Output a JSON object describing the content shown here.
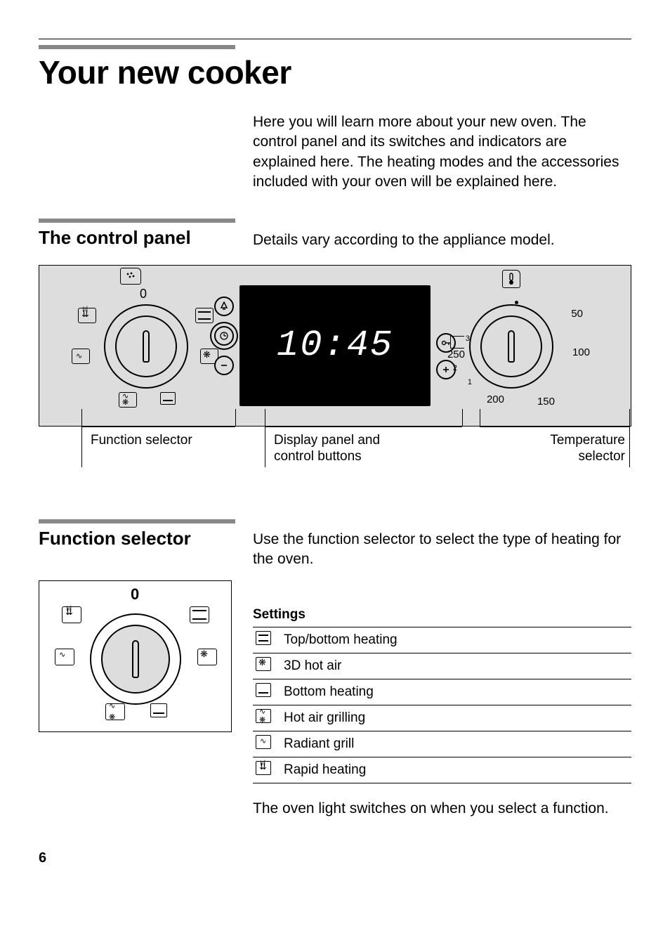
{
  "title": "Your new cooker",
  "intro": "Here you will learn more about your new oven. The control panel and its switches and indicators are explained here. The heating modes and the accessories included with your oven will be explained here.",
  "control_panel": {
    "heading": "The control panel",
    "note": "Details vary according to the appliance model.",
    "display_time": "10:45",
    "callouts": {
      "function": "Function selector",
      "display": "Display panel and control buttons",
      "temperature": "Temperature selector"
    },
    "function_dial_zero": "0",
    "temp_scale": {
      "t50": "50",
      "t100": "100",
      "t150": "150",
      "t200": "200",
      "t250": "250",
      "t1": "1",
      "t2": "2"
    }
  },
  "function_selector": {
    "heading": "Function selector",
    "intro": "Use the function selector to select the type of heating for the oven.",
    "knob_zero": "0",
    "settings_label": "Settings",
    "settings": [
      {
        "icon": "top-bottom-heating-icon",
        "label": "Top/bottom heating"
      },
      {
        "icon": "3d-hot-air-icon",
        "label": "3D hot air"
      },
      {
        "icon": "bottom-heating-icon",
        "label": "Bottom heating"
      },
      {
        "icon": "hot-air-grilling-icon",
        "label": "Hot air grilling"
      },
      {
        "icon": "radiant-grill-icon",
        "label": "Radiant grill"
      },
      {
        "icon": "rapid-heating-icon",
        "label": "Rapid heating"
      }
    ],
    "after": "The oven light switches on when you select a function."
  },
  "page_number": "6"
}
